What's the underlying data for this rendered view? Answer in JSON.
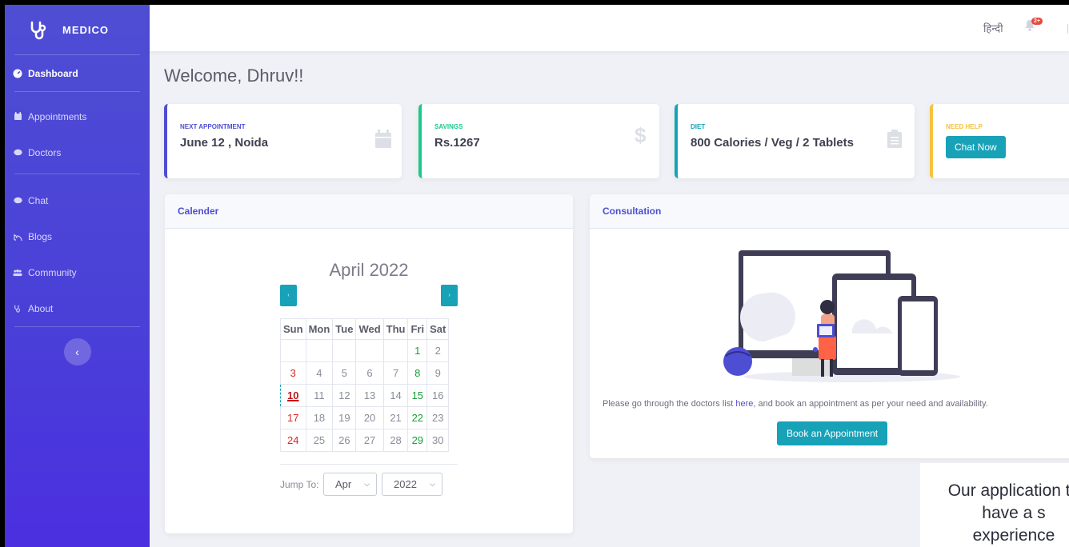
{
  "brand": {
    "name": "MEDICO",
    "logo_icon": "stethoscope-icon"
  },
  "sidebar": {
    "items": [
      {
        "label": "Dashboard",
        "icon": "dashboard-icon",
        "active": true
      },
      {
        "label": "Appointments",
        "icon": "calendar-icon"
      },
      {
        "label": "Doctors",
        "icon": "comment-icon"
      },
      {
        "label": "Chat",
        "icon": "comment-icon"
      },
      {
        "label": "Blogs",
        "icon": "blog-icon"
      },
      {
        "label": "Community",
        "icon": "users-icon"
      },
      {
        "label": "About",
        "icon": "stethoscope-icon"
      }
    ],
    "collapse_icon": "chevron-left-icon"
  },
  "topbar": {
    "language": "हिन्दी",
    "notification_count": "2+"
  },
  "welcome": "Welcome, Dhruv!!",
  "cards": [
    {
      "label": "NEXT APPOINTMENT",
      "value": "June 12 , Noida",
      "color": "#4e4ed3",
      "icon": "calendar-icon"
    },
    {
      "label": "SAVINGS",
      "value": "Rs.1267",
      "color": "#1cc88a",
      "icon": "dollar-icon"
    },
    {
      "label": "DIET",
      "value": "800 Calories / Veg / 2 Tablets",
      "color": "#17a2b8",
      "icon": "clipboard-icon"
    },
    {
      "label": "NEED HELP",
      "button": "Chat Now",
      "color": "#f6c23e"
    }
  ],
  "calendar": {
    "panel_title": "Calender",
    "month_title": "April 2022",
    "weekdays": [
      "Sun",
      "Mon",
      "Tue",
      "Wed",
      "Thu",
      "Fri",
      "Sat"
    ],
    "weeks": [
      [
        "",
        "",
        "",
        "",
        "",
        "1",
        "2"
      ],
      [
        "3",
        "4",
        "5",
        "6",
        "7",
        "8",
        "9"
      ],
      [
        "10",
        "11",
        "12",
        "13",
        "14",
        "15",
        "16"
      ],
      [
        "17",
        "18",
        "19",
        "20",
        "21",
        "22",
        "23"
      ],
      [
        "24",
        "25",
        "26",
        "27",
        "28",
        "29",
        "30"
      ]
    ],
    "today": "10",
    "jump_label": "Jump To:",
    "month_select": "Apr",
    "year_select": "2022"
  },
  "consultation": {
    "panel_title": "Consultation",
    "text_before": "Please go through the doctors list ",
    "link": "here",
    "text_after": ", and book an appointment as per your need and availability.",
    "button": "Book an Appointment"
  },
  "overlay_text": "Our application to have a s experience"
}
